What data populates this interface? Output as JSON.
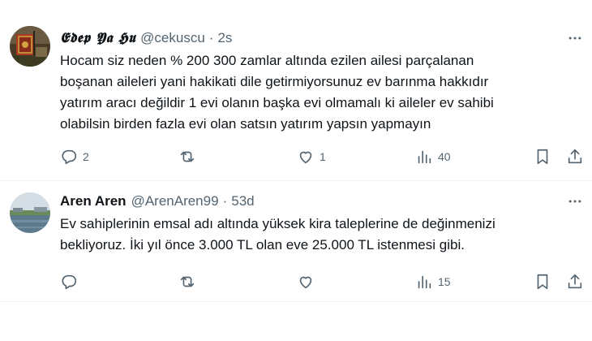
{
  "tweets": [
    {
      "display_name": "𝕰𝖉𝖊𝖕 𝖄𝖆 𝕳𝖚",
      "handle": "@cekuscu",
      "separator": "·",
      "time": "2s",
      "text_lines": [
        "Hocam siz neden % 200 300 zamlar altında ezilen ailesi parçalanan",
        "boşanan aileleri yani hakikati dile getirmiyorsunuz ev barınma hakkıdır",
        "yatırım aracı değildir 1 evi olanın başka evi olmamalı ki aileler ev sahibi",
        "olabilsin birden fazla evi olan satsın yatırım yapsın yapmayın"
      ],
      "replies": "2",
      "retweets": "",
      "likes": "1",
      "views": "40",
      "avatar_colors": [
        "#5a2a1f",
        "#a83a22",
        "#cfa440",
        "#3d3a22"
      ]
    },
    {
      "display_name": "Aren Aren",
      "handle": "@ArenAren99",
      "separator": "·",
      "time": "53d",
      "text_lines": [
        "Ev sahiplerinin emsal adı altında yüksek kira taleplerine de değinmenizi",
        "bekliyoruz. İki yıl önce 3.000 TL olan eve 25.000 TL istenmesi gibi."
      ],
      "replies": "",
      "retweets": "",
      "likes": "",
      "views": "15",
      "avatar_colors": [
        "#c9d6e0",
        "#5d7a8c",
        "#6b8a5c",
        "#f0f3f5"
      ]
    }
  ],
  "icons": {
    "reply": "speech-bubble-icon",
    "retweet": "retweet-arrows-icon",
    "like": "heart-outline-icon",
    "views": "bar-chart-icon",
    "bookmark": "bookmark-icon",
    "share": "share-upload-icon",
    "more": "more-dots-icon"
  },
  "colors": {
    "text": "#0f1419",
    "secondary": "#536471",
    "divider": "#eff3f4"
  }
}
